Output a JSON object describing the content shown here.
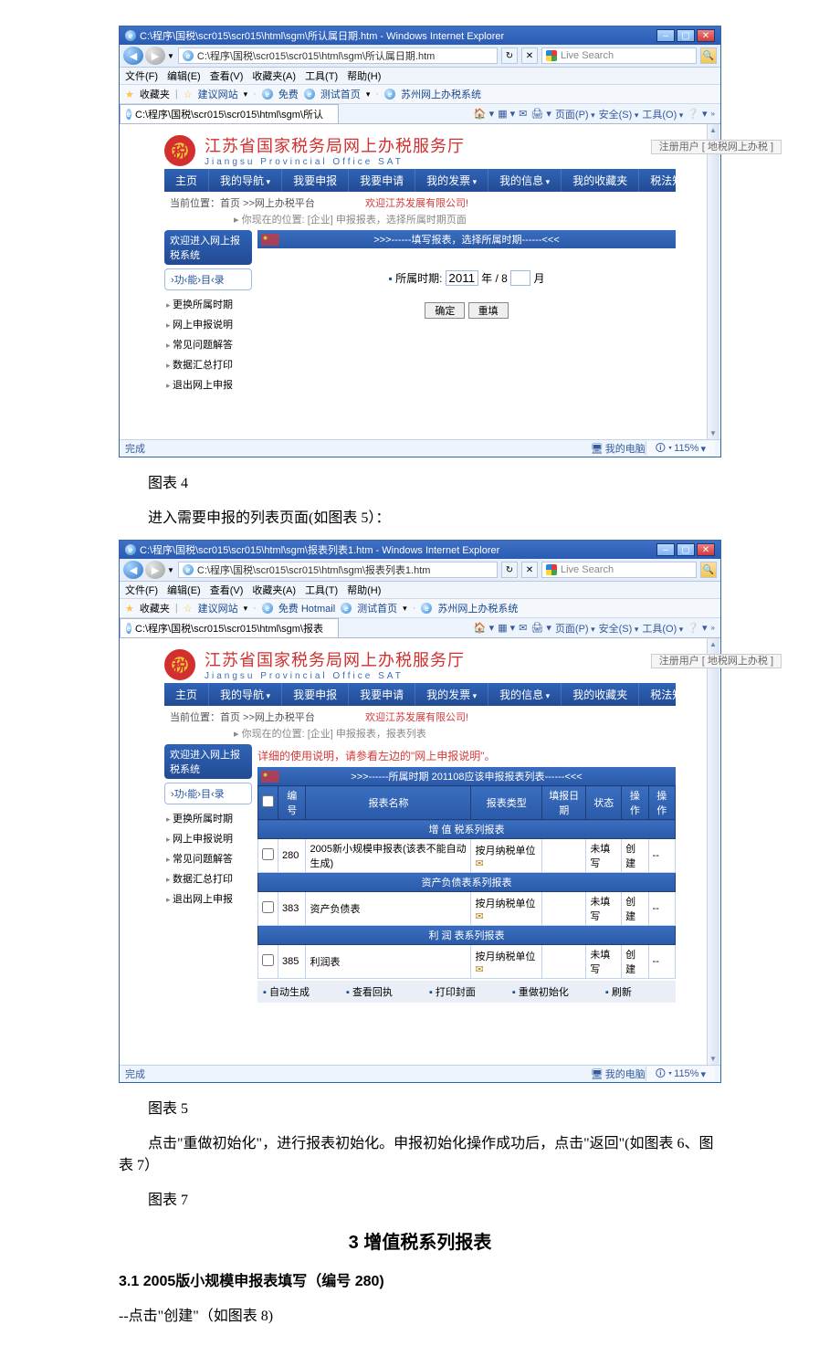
{
  "chrome": {
    "path4": "C:\\程序\\国税\\scr015\\scr015\\html\\sgm\\所认属日期.htm - Windows Internet Explorer",
    "url4": "C:\\程序\\国税\\scr015\\scr015\\html\\sgm\\所认属日期.htm",
    "path5": "C:\\程序\\国税\\scr015\\scr015\\html\\sgm\\报表列表1.htm - Windows Internet Explorer",
    "url5": "C:\\程序\\国税\\scr015\\scr015\\html\\sgm\\报表列表1.htm",
    "menu": [
      "文件(F)",
      "编辑(E)",
      "查看(V)",
      "收藏夹(A)",
      "工具(T)",
      "帮助(H)"
    ],
    "fav_label": "收藏夹",
    "fav_items4": [
      "建议网站",
      "免费",
      "测试首页",
      "苏州网上办税系统"
    ],
    "fav_items5": [
      "建议网站",
      "免费 Hotmail",
      "测试首页",
      "苏州网上办税系统"
    ],
    "tab4": "C:\\程序\\国税\\scr015\\scr015\\html\\sgm\\所认",
    "tab5": "C:\\程序\\国税\\scr015\\scr015\\html\\sgm\\报表",
    "cmdbar": [
      "页面(P)",
      "安全(S)",
      "工具(O)"
    ],
    "search_placeholder": "Live Search",
    "status_done": "完成",
    "zone": "我的电脑",
    "zoom": "115%"
  },
  "app": {
    "title_cn": "江苏省国家税务局网上办税服务厅",
    "title_en": "Jiangsu Provincial Office SAT",
    "reg_btn": "注册用户 [ 地税网上办税 ]",
    "nav": [
      "主页",
      "我的导航",
      "我要申报",
      "我要申请",
      "我的发票",
      "我的信息",
      "我的收藏夹",
      "税法知识库"
    ],
    "crumb4_main": "当前位置：首页 >>网上办税平台",
    "crumb4_sub": "▸ 你现在的位置: [企业] 申报报表，选择所属时期页面",
    "crumb5_main": "当前位置：首页 >>网上办税平台",
    "crumb5_sub": "▸ 你现在的位置: [企业] 申报报表，报表列表",
    "welcome": "欢迎江苏发展有限公司!",
    "side_title": "欢迎进入网上报税系统",
    "side_sub": "›功‹能›目‹录",
    "side_items": [
      "更换所属时期",
      "网上申报说明",
      "常见问题解答",
      "数据汇总打印",
      "退出网上申报"
    ]
  },
  "fig4": {
    "panel_title": ">>>------填写报表，选择所属时期------<<<",
    "field_label": "所属时期:",
    "year": "2011",
    "yr_suffix": "年 / 8",
    "mo_suffix": "月",
    "btn_ok": "确定",
    "btn_reset": "重填"
  },
  "fig5": {
    "notice": "详细的使用说明，请参看左边的\"网上申报说明\"。",
    "panel_title": ">>>------所属时期 201108应该申报报表列表------<<<",
    "headers": [
      "",
      "编号",
      "报表名称",
      "报表类型",
      "填报日期",
      "状态",
      "操作",
      "操作"
    ],
    "groups": [
      {
        "title": "增 值 税系列报表",
        "rows": [
          {
            "no": "280",
            "name": "2005新小规模申报表(该表不能自动生成)",
            "type": "按月纳税单位",
            "due": "",
            "status": "未填写",
            "op1": "创建",
            "op2": "--"
          }
        ]
      },
      {
        "title": "资产负债表系列报表",
        "rows": [
          {
            "no": "383",
            "name": "资产负债表",
            "type": "按月纳税单位",
            "due": "",
            "status": "未填写",
            "op1": "创建",
            "op2": "--"
          }
        ]
      },
      {
        "title": "利 润 表系列报表",
        "rows": [
          {
            "no": "385",
            "name": "利润表",
            "type": "按月纳税单位",
            "due": "",
            "status": "未填写",
            "op1": "创建",
            "op2": "--"
          }
        ]
      }
    ],
    "actions": [
      "自动生成",
      "查看回执",
      "打印封面",
      "重做初始化",
      "刷新"
    ]
  },
  "doc": {
    "cap4": "图表 4",
    "p4": "进入需要申报的列表页面(如图表 5）：",
    "cap5": "图表 5",
    "p5": "点击\"重做初始化\"，进行报表初始化。申报初始化操作成功后，点击\"返回\"(如图表 6、图表 7）",
    "cap7": "图表 7",
    "h3": "3 增值税系列报表",
    "h31": "3.1 2005版小规模申报表填写（编号 280)",
    "p31": "--点击\"创建\"（如图表 8)"
  }
}
